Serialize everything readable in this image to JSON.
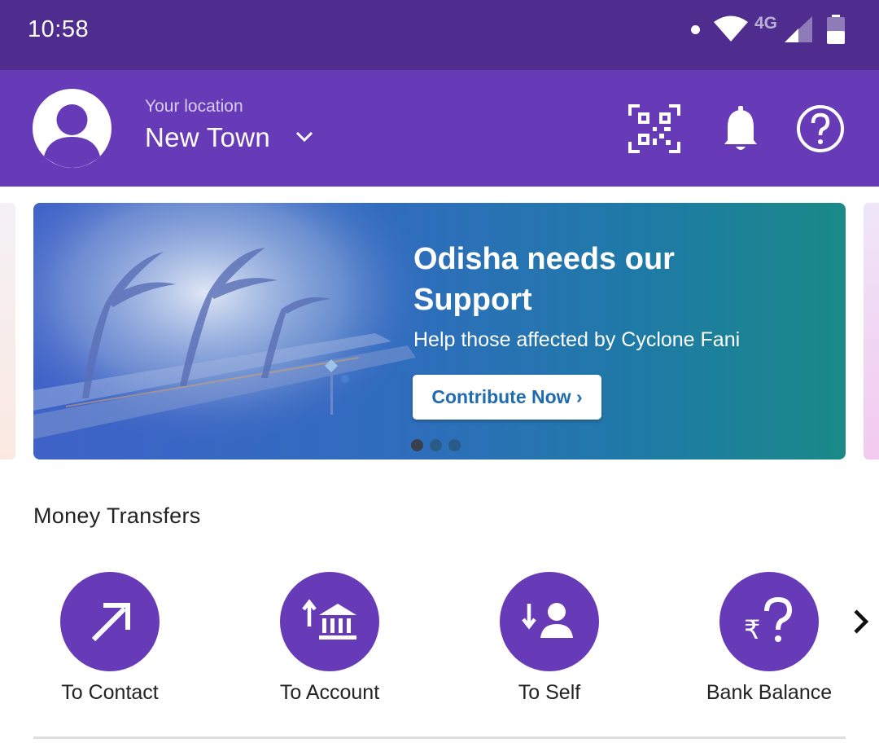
{
  "status_bar": {
    "time": "10:58",
    "network": "4G"
  },
  "header": {
    "location_caption": "Your location",
    "location_city": "New Town",
    "icons": [
      "avatar-icon",
      "chevron-down-icon",
      "qr-scan-icon",
      "bell-icon",
      "help-icon"
    ]
  },
  "banner": {
    "title": "Odisha needs our Support",
    "subtitle": "Help those affected by Cyclone Fani",
    "cta_label": "Contribute Now ›",
    "slide_count": 3,
    "active_slide": 1
  },
  "money_transfers": {
    "title": "Money Transfers",
    "items": [
      {
        "label": "To Contact",
        "icon": "arrow-up-right-icon"
      },
      {
        "label": "To Account",
        "icon": "bank-upload-icon"
      },
      {
        "label": "To Self",
        "icon": "person-download-icon"
      },
      {
        "label": "Bank Balance",
        "icon": "rupee-question-icon"
      }
    ],
    "next_icon": "chevron-right-icon"
  },
  "colors": {
    "status_bar": "#4f2d8f",
    "brand_purple": "#673ab7",
    "cta_text": "#1e6bb0"
  }
}
